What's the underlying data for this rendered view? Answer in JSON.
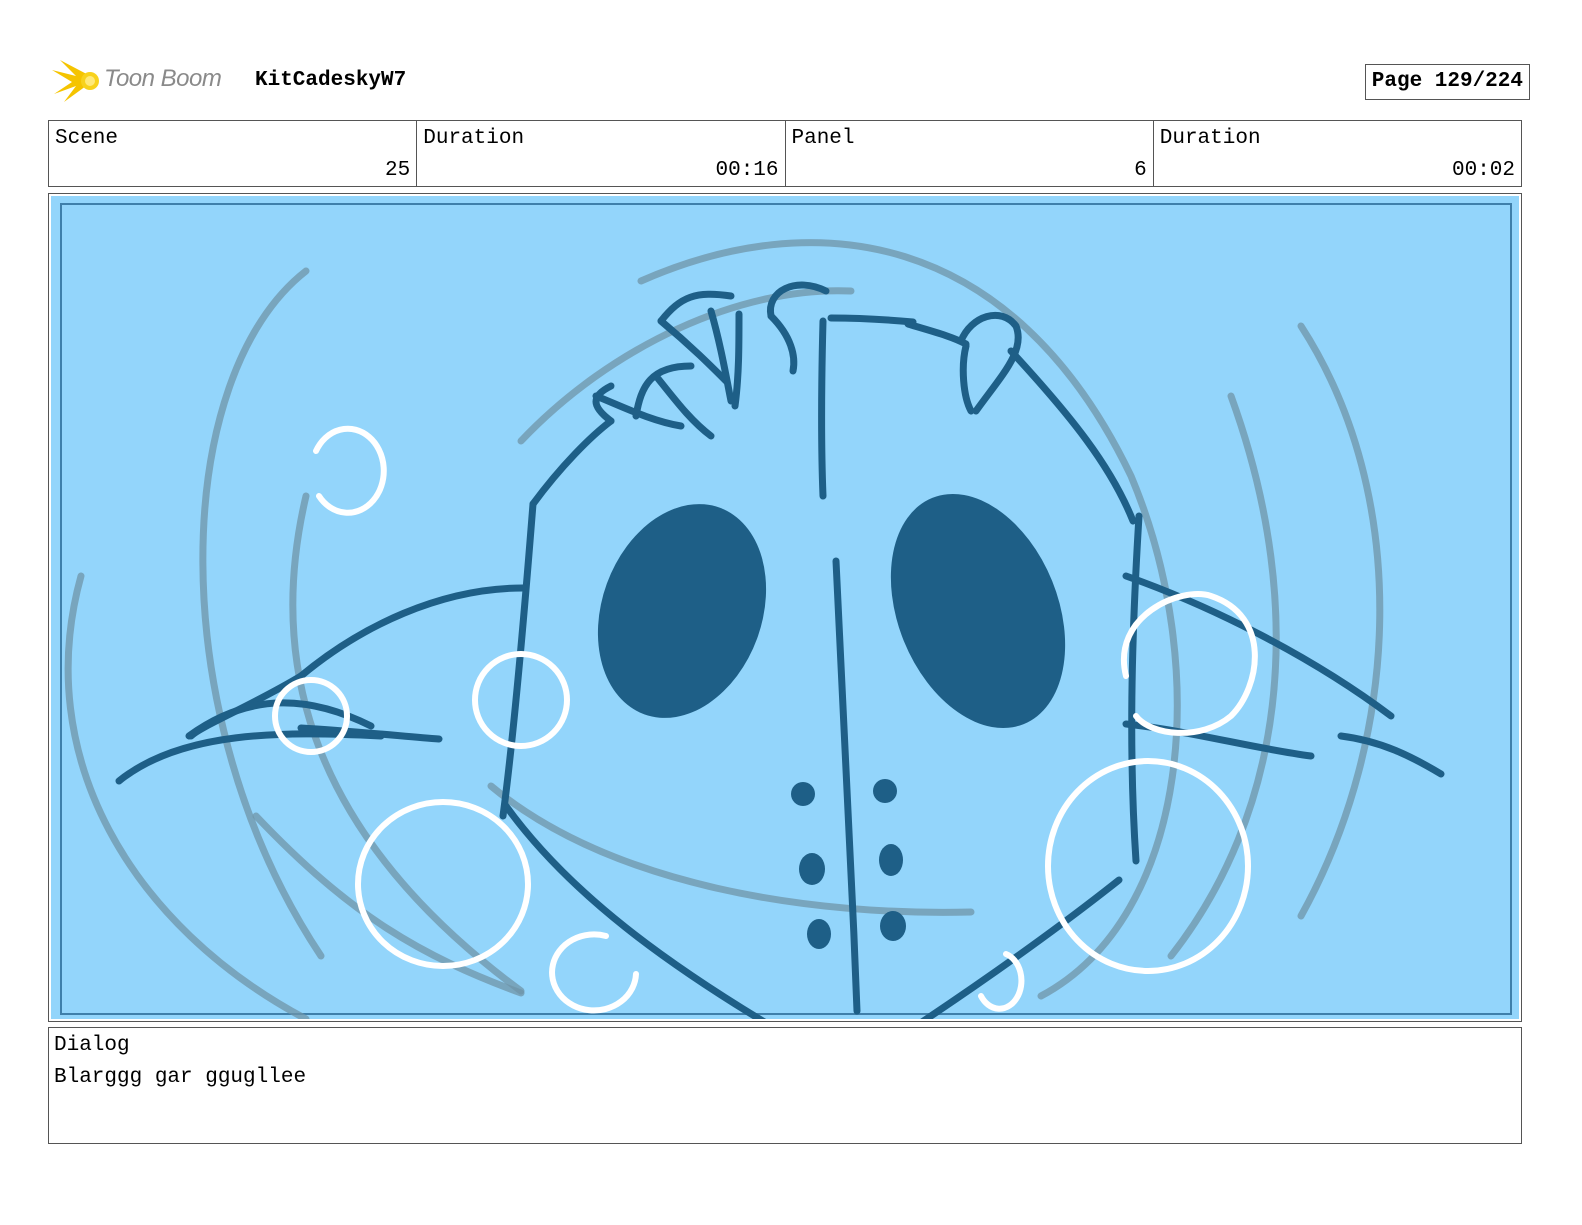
{
  "header": {
    "brand": "Toon Boom",
    "project": "KitCadeskyW7",
    "page": "Page 129/224"
  },
  "info": {
    "scene_label": "Scene",
    "scene_value": "25",
    "duration_label": "Duration",
    "duration_value": "00:16",
    "panel_label": "Panel",
    "panel_value": "6",
    "panel_duration_label": "Duration",
    "panel_duration_value": "00:02"
  },
  "dialog": {
    "label": "Dialog",
    "text": "Blarggg gar ggugllee"
  },
  "colors": {
    "sky": "#93d5fb",
    "ink": "#1e5f87",
    "swirl": "#6f94a8",
    "bubble": "#ffffff",
    "logo": "#f5c400"
  }
}
